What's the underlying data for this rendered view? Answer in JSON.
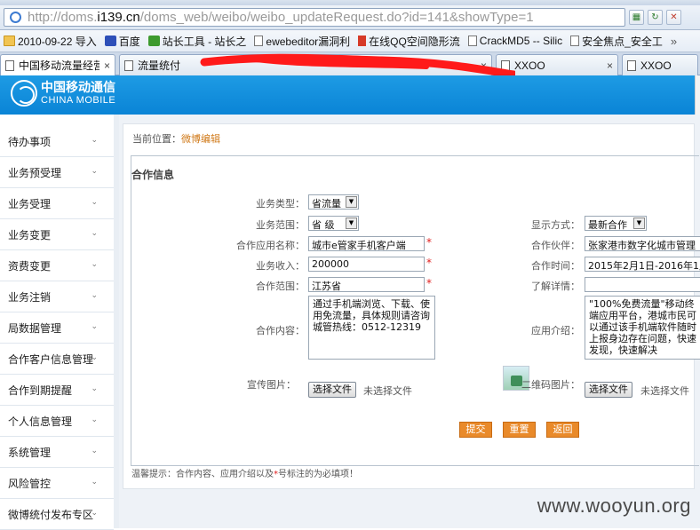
{
  "browser": {
    "url_prefix": "http://doms.",
    "url_host": "i139.cn",
    "url_rest": "/doms_web/weibo/weibo_updateRequest.do?id=141&showType=1",
    "bookmarks": [
      {
        "label": "2010-09-22 导入",
        "icon": "folder-icon"
      },
      {
        "label": "百度",
        "icon": "baidu-icon"
      },
      {
        "label": "站长工具 - 站长之",
        "icon": "chinaz-icon"
      },
      {
        "label": "ewebeditor漏洞利",
        "icon": "page-icon"
      },
      {
        "label": "在线QQ空间隐形流",
        "icon": "qq-icon"
      },
      {
        "label": "CrackMD5 -- Silic",
        "icon": "page-icon"
      },
      {
        "label": "安全焦点_安全工",
        "icon": "page-icon"
      }
    ],
    "bookmarks_more": "»",
    "tabs": [
      {
        "label": "中国移动流量经营",
        "active": true
      },
      {
        "label": "流量统付",
        "active": false
      },
      {
        "label": "XXOO",
        "active": false
      },
      {
        "label": "XXOO",
        "active": false
      }
    ],
    "tab_close": "×"
  },
  "app": {
    "logo_cn": "中国移动通信",
    "logo_en": "CHINA MOBILE"
  },
  "sidenav": {
    "items": [
      "待办事项",
      "业务预受理",
      "业务受理",
      "业务变更",
      "资费变更",
      "业务注销",
      "局数据管理",
      "合作客户信息管理",
      "合作到期提醒",
      "个人信息管理",
      "系统管理",
      "风险管控",
      "微博统付发布专区"
    ],
    "chevron": "⌄"
  },
  "page": {
    "breadcrumb_prefix": "当前位置：",
    "breadcrumb_current": "微博编辑",
    "section_title": "合作信息"
  },
  "form": {
    "business_type_label": "业务类型：",
    "business_type_value": "省流量",
    "business_scope_label": "业务范围：",
    "business_scope_value": "省  级",
    "display_mode_label": "显示方式：",
    "display_mode_value": "最新合作",
    "app_name_label": "合作应用名称：",
    "app_name_value": "城市e管家手机客户端",
    "partner_label": "合作伙伴：",
    "partner_value": "张家港市数字化城市管理",
    "revenue_label": "业务收入：",
    "revenue_value": "200000",
    "period_label": "合作时间：",
    "period_value": "2015年2月1日-2016年1月",
    "coop_scope_label": "合作范围：",
    "coop_scope_value": "江苏省",
    "details_label": "了解详情：",
    "details_value": "",
    "content_label": "合作内容：",
    "content_value": "通过手机端浏览、下载、使用免流量，具体规则请咨询城管热线：0512-12319",
    "intro_label": "应用介绍：",
    "intro_value": "\"100%免费流量\"移动终端应用平台，港城市民可以通过该手机端软件随时上报身边存在问题，快速发现，快速解决",
    "promo_image_label": "宣传图片：",
    "qr_image_label": "二维码图片：",
    "choose_file": "选择文件",
    "no_file": "未选择文件",
    "required_mark": "*"
  },
  "actions": {
    "submit": "提交",
    "reset": "重置",
    "back": "返回"
  },
  "hint": {
    "prefix": "温馨提示：合作内容、应用介绍以及",
    "star": "*",
    "suffix": "号标注的为必填项！"
  },
  "watermark": "www.wooyun.org"
}
